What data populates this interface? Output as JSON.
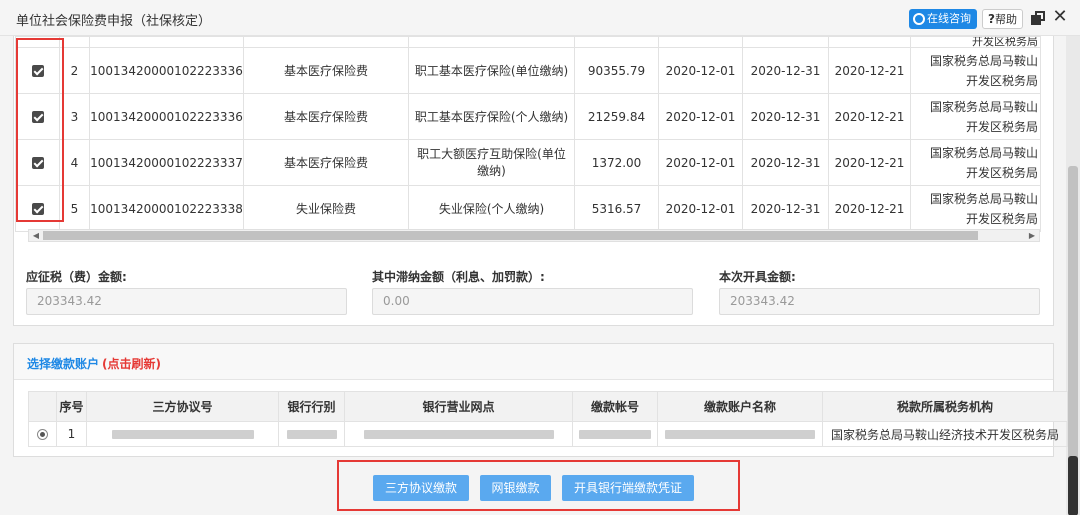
{
  "window": {
    "title": "单位社会保险费申报（社保核定）",
    "consult_label": "在线咨询",
    "help_label": "帮助",
    "accent_color": "#1e88e5"
  },
  "tax_table": {
    "partial_row_org": "开发区税务局",
    "rows": [
      {
        "checked": true,
        "seq": "2",
        "code": "10013420000102223336",
        "fee_type": "基本医疗保险费",
        "item": "职工基本医疗保险(单位缴纳)",
        "amount": "90355.79",
        "start": "2020-12-01",
        "end": "2020-12-31",
        "deadline": "2020-12-21",
        "org_line1": "国家税务总局马鞍山",
        "org_line2": "开发区税务局"
      },
      {
        "checked": true,
        "seq": "3",
        "code": "10013420000102223336",
        "fee_type": "基本医疗保险费",
        "item": "职工基本医疗保险(个人缴纳)",
        "amount": "21259.84",
        "start": "2020-12-01",
        "end": "2020-12-31",
        "deadline": "2020-12-21",
        "org_line1": "国家税务总局马鞍山",
        "org_line2": "开发区税务局"
      },
      {
        "checked": true,
        "seq": "4",
        "code": "10013420000102223337",
        "fee_type": "基本医疗保险费",
        "item": "职工大额医疗互助保险(单位缴纳)",
        "amount": "1372.00",
        "start": "2020-12-01",
        "end": "2020-12-31",
        "deadline": "2020-12-21",
        "org_line1": "国家税务总局马鞍山",
        "org_line2": "开发区税务局"
      },
      {
        "checked": true,
        "seq": "5",
        "code": "10013420000102223338",
        "fee_type": "失业保险费",
        "item": "失业保险(个人缴纳)",
        "amount": "5316.57",
        "start": "2020-12-01",
        "end": "2020-12-31",
        "deadline": "2020-12-21",
        "org_line1": "国家税务总局马鞍山",
        "org_line2": "开发区税务局"
      }
    ]
  },
  "summary": {
    "due_label": "应征税（费）金额:",
    "due_value": "203343.42",
    "late_label": "其中滞纳金额（利息、加罚款）:",
    "late_value": "0.00",
    "issue_label": "本次开具金额:",
    "issue_value": "203343.42"
  },
  "account_section": {
    "title": "选择缴款账户",
    "refresh_label": "(点击刷新)",
    "headers": [
      "序号",
      "三方协议号",
      "银行行别",
      "银行营业网点",
      "缴款帐号",
      "缴款账户名称",
      "税款所属税务机构"
    ],
    "rows": [
      {
        "selected": true,
        "seq": "1",
        "org": "国家税务总局马鞍山经济技术开发区税务局"
      }
    ]
  },
  "actions": {
    "tripartite_pay": "三方协议缴款",
    "online_bank_pay": "网银缴款",
    "bank_voucher": "开具银行端缴款凭证"
  }
}
